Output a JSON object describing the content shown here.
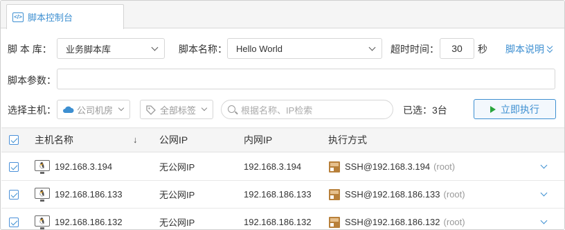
{
  "tab": {
    "label": "脚本控制台",
    "icon": "code-icon"
  },
  "form": {
    "library_label": "脚 本 库：",
    "library_value": "业务脚本库",
    "script_name_label": "脚本名称：",
    "script_name_value": "Hello World",
    "timeout_label": "超时时间：",
    "timeout_value": "30",
    "timeout_unit": "秒",
    "help_link": "脚本说明",
    "params_label": "脚本参数：",
    "params_value": ""
  },
  "host_select": {
    "label": "选择主机：",
    "room_filter": "公司机房",
    "tag_filter": "全部标签",
    "search_placeholder": "根据名称、IP检索",
    "selected_text": "已选：3台",
    "run_button": "立即执行"
  },
  "table": {
    "headers": {
      "name": "主机名称",
      "public_ip": "公网IP",
      "private_ip": "内网IP",
      "method": "执行方式"
    },
    "rows": [
      {
        "name": "192.168.3.194",
        "public_ip": "无公网IP",
        "private_ip": "192.168.3.194",
        "method": "SSH@192.168.3.194",
        "user": "(root)"
      },
      {
        "name": "192.168.186.133",
        "public_ip": "无公网IP",
        "private_ip": "192.168.186.133",
        "method": "SSH@192.168.186.133",
        "user": "(root)"
      },
      {
        "name": "192.168.186.132",
        "public_ip": "无公网IP",
        "private_ip": "192.168.186.132",
        "method": "SSH@192.168.186.132",
        "user": "(root)"
      }
    ]
  },
  "colors": {
    "accent": "#3d8fd1",
    "run_icon": "#2aa53c"
  }
}
